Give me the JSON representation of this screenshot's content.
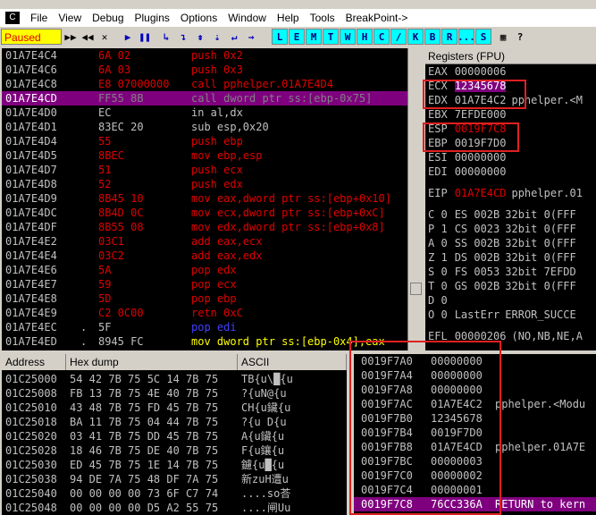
{
  "menu": {
    "icon": "app-icon",
    "items": [
      "File",
      "View",
      "Debug",
      "Plugins",
      "Options",
      "Window",
      "Help",
      "Tools",
      "BreakPoint->"
    ]
  },
  "toolbar": {
    "status": "Paused",
    "buttons": [
      "open",
      "rewind",
      "close",
      "run",
      "pause",
      "step-into",
      "step-over",
      "trace-into",
      "trace-over",
      "execute-till-return",
      "goto"
    ],
    "glyphs": [
      "▶▶",
      "◀◀",
      "✕",
      "▶",
      "❚❚",
      "↳",
      "↴",
      "⇟",
      "⇣",
      "↵",
      "→"
    ],
    "letters": [
      "L",
      "E",
      "M",
      "T",
      "W",
      "H",
      "C",
      "/",
      "K",
      "B",
      "R",
      "...",
      "S"
    ]
  },
  "cpu": {
    "rows": [
      {
        "addr": "01A7E4C4",
        "dot": "",
        "hex": "6A 02",
        "ins": "push 0x2"
      },
      {
        "addr": "01A7E4C6",
        "dot": "",
        "hex": "6A 03",
        "ins": "push 0x3"
      },
      {
        "addr": "01A7E4C8",
        "dot": "",
        "hex": "E8 07000000",
        "ins": "call pphelper.01A7E4D4"
      },
      {
        "addr": "01A7E4CD",
        "dot": "",
        "hex": "FF55 8B",
        "ins": "call dword ptr ss:[ebp-0x75]",
        "sel": true
      },
      {
        "addr": "01A7E4D0",
        "dot": "",
        "hex": "EC",
        "ins": "in al,dx",
        "gray": true
      },
      {
        "addr": "01A7E4D1",
        "dot": "",
        "hex": "83EC 20",
        "ins": "sub esp,0x20",
        "gray": true
      },
      {
        "addr": "01A7E4D4",
        "dot": "",
        "hex": "55",
        "ins": "push ebp"
      },
      {
        "addr": "01A7E4D5",
        "dot": "",
        "hex": "8BEC",
        "ins": "mov ebp,esp"
      },
      {
        "addr": "01A7E4D7",
        "dot": "",
        "hex": "51",
        "ins": "push ecx"
      },
      {
        "addr": "01A7E4D8",
        "dot": "",
        "hex": "52",
        "ins": "push edx"
      },
      {
        "addr": "01A7E4D9",
        "dot": "",
        "hex": "8B45 10",
        "ins": "mov eax,dword ptr ss:[ebp+0x10]"
      },
      {
        "addr": "01A7E4DC",
        "dot": "",
        "hex": "8B4D 0C",
        "ins": "mov ecx,dword ptr ss:[ebp+0xC]"
      },
      {
        "addr": "01A7E4DF",
        "dot": "",
        "hex": "8B55 08",
        "ins": "mov edx,dword ptr ss:[ebp+0x8]"
      },
      {
        "addr": "01A7E4E2",
        "dot": "",
        "hex": "03C1",
        "ins": "add eax,ecx"
      },
      {
        "addr": "01A7E4E4",
        "dot": "",
        "hex": "03C2",
        "ins": "add eax,edx"
      },
      {
        "addr": "01A7E4E6",
        "dot": "",
        "hex": "5A",
        "ins": "pop edx"
      },
      {
        "addr": "01A7E4E7",
        "dot": "",
        "hex": "59",
        "ins": "pop ecx"
      },
      {
        "addr": "01A7E4E8",
        "dot": "",
        "hex": "5D",
        "ins": "pop ebp"
      },
      {
        "addr": "01A7E4E9",
        "dot": "",
        "hex": "C2 0C00",
        "ins": "retn 0xC"
      },
      {
        "addr": "01A7E4EC",
        "dot": ".",
        "hex": "5F",
        "ins": "pop edi",
        "blue": true
      },
      {
        "addr": "01A7E4ED",
        "dot": ".",
        "hex": "8945 FC",
        "ins": "mov dword ptr ss:[ebp-0x4],eax",
        "yellow": true
      }
    ]
  },
  "registers": {
    "title": "Registers (FPU)",
    "lines": [
      {
        "n": "EAX",
        "v": "00000006",
        "c": ""
      },
      {
        "n": "ECX",
        "v": "12345678",
        "c": "",
        "hl": true
      },
      {
        "n": "EDX",
        "v": "01A7E4C2",
        "c": "pphelper.<M"
      },
      {
        "n": "EBX",
        "v": "7EFDE000",
        "c": ""
      },
      {
        "n": "ESP",
        "v": "0019F7C8",
        "c": "",
        "red": true
      },
      {
        "n": "EBP",
        "v": "0019F7D0",
        "c": ""
      },
      {
        "n": "ESI",
        "v": "00000000",
        "c": ""
      },
      {
        "n": "EDI",
        "v": "00000000",
        "c": ""
      },
      {
        "gap": true
      },
      {
        "n": "EIP",
        "v": "01A7E4CD",
        "c": "pphelper.01",
        "red": true
      },
      {
        "gap": true
      },
      {
        "n": "C 0",
        "v": "ES 002B",
        "c": "32bit 0(FFF"
      },
      {
        "n": "P 1",
        "v": "CS 0023",
        "c": "32bit 0(FFF"
      },
      {
        "n": "A 0",
        "v": "SS 002B",
        "c": "32bit 0(FFF"
      },
      {
        "n": "Z 1",
        "v": "DS 002B",
        "c": "32bit 0(FFF"
      },
      {
        "n": "S 0",
        "v": "FS 0053",
        "c": "32bit 7EFDD"
      },
      {
        "n": "T 0",
        "v": "GS 002B",
        "c": "32bit 0(FFF"
      },
      {
        "n": "D 0",
        "v": "",
        "c": ""
      },
      {
        "n": "O 0",
        "v": "LastErr",
        "c": "ERROR_SUCCE"
      },
      {
        "gap": true
      },
      {
        "n": "EFL",
        "v": "00000206",
        "c": "(NO,NB,NE,A"
      }
    ]
  },
  "dump": {
    "headers": [
      "Address",
      "Hex dump",
      "ASCII"
    ],
    "rows": [
      {
        "a": "01C25000",
        "h": "54 42 7B 75 5C 14 7B 75",
        "t": "TB{u\\█{u"
      },
      {
        "a": "01C25008",
        "h": "FB 13 7B 75 4E 40 7B 75",
        "t": "?{uN@{u"
      },
      {
        "a": "01C25010",
        "h": "43 48 7B 75 FD 45 7B 75",
        "t": "CH{u鑶{u"
      },
      {
        "a": "01C25018",
        "h": "BA 11 7B 75 04 44 7B 75",
        "t": "?{u D{u"
      },
      {
        "a": "01C25020",
        "h": "03 41 7B 75 DD 45 7B 75",
        "t": "A{u鑶{u"
      },
      {
        "a": "01C25028",
        "h": "18 46 7B 75 DE 40 7B 75",
        "t": "F{u鑲{u"
      },
      {
        "a": "01C25030",
        "h": "ED 45 7B 75 1E 14 7B 75",
        "t": "鑢{u█{u"
      },
      {
        "a": "01C25038",
        "h": "94 DE 7A 75 48 DF 7A 75",
        "t": "新zuH遭u"
      },
      {
        "a": "01C25040",
        "h": "00 00 00 00 73 6F C7 74",
        "t": "....so荅"
      },
      {
        "a": "01C25048",
        "h": "00 00 00 00 D5 A2 55 75",
        "t": "....闸Uu"
      }
    ]
  },
  "stack": {
    "rows": [
      {
        "a": "0019F7A0",
        "v": "00000000",
        "c": ""
      },
      {
        "a": "0019F7A4",
        "v": "00000000",
        "c": ""
      },
      {
        "a": "0019F7A8",
        "v": "00000000",
        "c": ""
      },
      {
        "a": "0019F7AC",
        "v": "01A7E4C2",
        "c": "pphelper.<Modu"
      },
      {
        "a": "0019F7B0",
        "v": "12345678",
        "c": ""
      },
      {
        "a": "0019F7B4",
        "v": "0019F7D0",
        "c": ""
      },
      {
        "a": "0019F7B8",
        "v": "01A7E4CD",
        "c": "pphelper.01A7E"
      },
      {
        "a": "0019F7BC",
        "v": "00000003",
        "c": ""
      },
      {
        "a": "0019F7C0",
        "v": "00000002",
        "c": ""
      },
      {
        "a": "0019F7C4",
        "v": "00000001",
        "c": ""
      },
      {
        "a": "0019F7C8",
        "v": "76CC336A",
        "c": "RETURN to kern",
        "cur": true
      }
    ]
  }
}
